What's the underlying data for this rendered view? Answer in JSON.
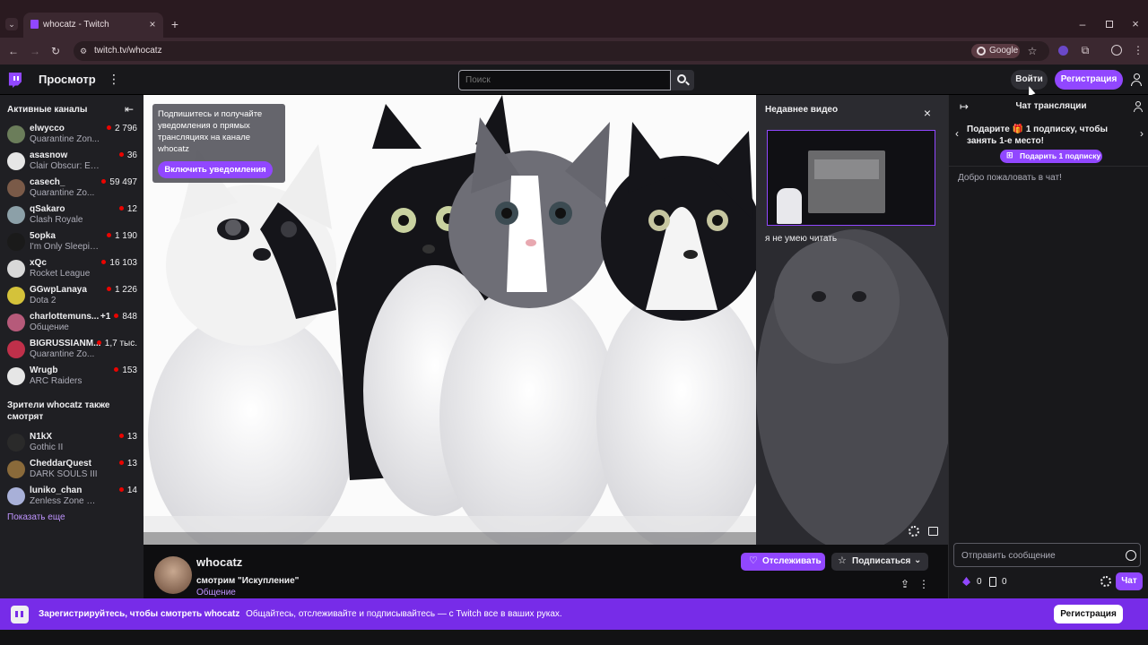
{
  "browser": {
    "tab_title": "whocatz - Twitch",
    "url": "twitch.tv/whocatz",
    "search_chip": "Google"
  },
  "nav": {
    "browse": "Просмотр",
    "search_placeholder": "Поиск",
    "login": "Войти",
    "signup": "Регистрация"
  },
  "sidebar": {
    "active_title": "Активные каналы",
    "channels": [
      {
        "name": "elwycco",
        "game": "Quarantine Zon...",
        "viewers": "2 796",
        "color": "#6b7d5a"
      },
      {
        "name": "asasnow",
        "game": "Clair Obscur: Exp...",
        "viewers": "36",
        "color": "#e6e6e6"
      },
      {
        "name": "casech_",
        "game": "Quarantine Zo...",
        "viewers": "59 497",
        "color": "#7a5a48"
      },
      {
        "name": "qSakaro",
        "game": "Clash Royale",
        "viewers": "12",
        "color": "#8ca0a8"
      },
      {
        "name": "5opka",
        "game": "I'm Only Sleeping",
        "viewers": "1 190",
        "color": "#1a1a1a"
      },
      {
        "name": "xQc",
        "game": "Rocket League",
        "viewers": "16 103",
        "color": "#d8d8d8"
      },
      {
        "name": "GGwpLanaya",
        "game": "Dota 2",
        "viewers": "1 226",
        "color": "#d4c23a"
      },
      {
        "name": "charlottemuns...",
        "game": "Общение",
        "viewers": "848",
        "extra": "+1",
        "color": "#b65a7a"
      },
      {
        "name": "BIGRUSSIANM...",
        "game": "Quarantine Zo...",
        "viewers": "1,7 тыс.",
        "color": "#c0304a"
      },
      {
        "name": "Wrugb",
        "game": "ARC Raiders",
        "viewers": "153",
        "color": "#e6e6e6"
      }
    ],
    "also_watch_title": "Зрители whocatz также смотрят",
    "also_watch": [
      {
        "name": "N1kX",
        "game": "Gothic II",
        "viewers": "13",
        "color": "#2a2a2a"
      },
      {
        "name": "CheddarQuest",
        "game": "DARK SOULS III",
        "viewers": "13",
        "color": "#8a6a3a"
      },
      {
        "name": "luniko_chan",
        "game": "Zenless Zone Zero",
        "viewers": "14",
        "color": "#a8b0d8"
      }
    ],
    "show_more": "Показать еще"
  },
  "player": {
    "notify_text": "Подпишитесь и получайте уведомления о прямых трансляциях на канале whocatz",
    "notify_button": "Включить уведомления",
    "recent_title": "Недавнее видео",
    "recent_video_title": "я не умею читать"
  },
  "channel": {
    "name": "whocatz",
    "stream_title": "смотрим \"Искупление\"",
    "category": "Общение",
    "follow": "Отслеживать",
    "subscribe": "Подписаться"
  },
  "chat": {
    "title": "Чат трансляции",
    "gift_text": "Подарите",
    "gift_count": "1",
    "gift_text2": "подписку, чтобы занять 1-е место!",
    "gift_button": "Подарить 1 подписку",
    "welcome": "Добро пожаловать в чат!",
    "input_placeholder": "Отправить сообщение",
    "bits": "0",
    "points": "0",
    "chat_button": "Чат"
  },
  "banner": {
    "bold": "Зарегистрируйтесь, чтобы смотреть whocatz",
    "text": "Общайтесь, отслеживайте и подписывайтесь — с Twitch все в ваших руках.",
    "button": "Регистрация"
  }
}
